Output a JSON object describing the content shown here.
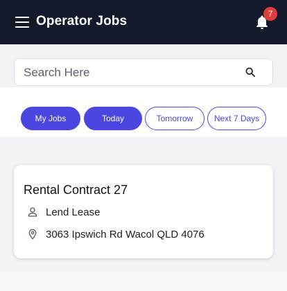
{
  "header": {
    "title": "Operator Jobs",
    "notification_count": "7",
    "menu_icon": "hamburger-menu-icon",
    "bell_icon": "bell-icon"
  },
  "search": {
    "placeholder": "Search Here",
    "value": "",
    "icon": "search-icon"
  },
  "filters": {
    "tabs": [
      {
        "label": "My Jobs",
        "selected": true
      },
      {
        "label": "Today",
        "selected": true
      },
      {
        "label": "Tomorrow",
        "selected": false
      },
      {
        "label": "Next 7 Days",
        "selected": false
      }
    ]
  },
  "jobs": [
    {
      "title": "Rental Contract 27",
      "client": "Lend Lease",
      "client_icon": "person-icon",
      "address": "3063 Ipswich Rd Wacol QLD 4076",
      "address_icon": "location-pin-icon"
    }
  ],
  "colors": {
    "header_bg": "#131a2b",
    "accent": "#4b46e0",
    "badge": "#e23b3b",
    "page_bg": "#f2f3f6"
  }
}
